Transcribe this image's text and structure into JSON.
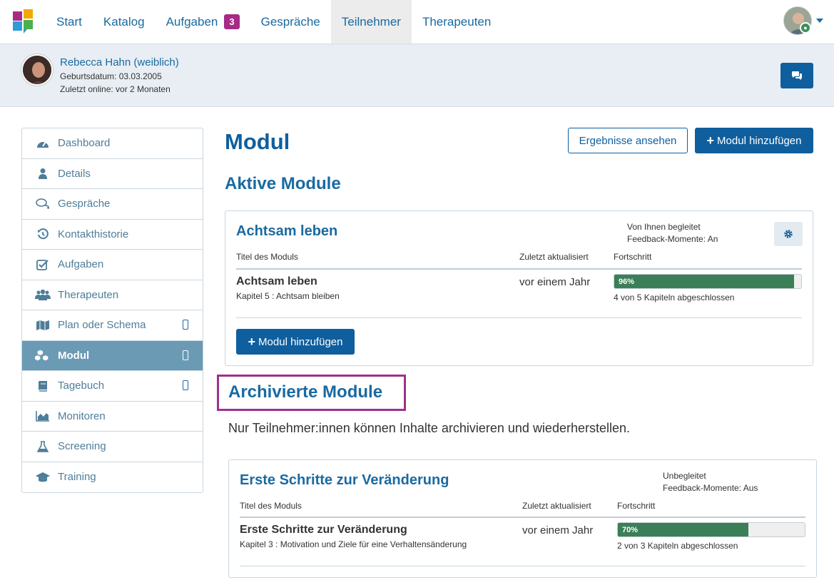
{
  "nav": {
    "items": [
      {
        "label": "Start"
      },
      {
        "label": "Katalog"
      },
      {
        "label": "Aufgaben",
        "badge": "3"
      },
      {
        "label": "Gespräche"
      },
      {
        "label": "Teilnehmer",
        "active": true
      },
      {
        "label": "Therapeuten"
      }
    ]
  },
  "participant": {
    "name": "Rebecca Hahn (weiblich)",
    "birthdate": "Geburtsdatum: 03.03.2005",
    "last_online": "Zuletzt online: vor 2 Monaten"
  },
  "sidebar": {
    "items": [
      {
        "label": "Dashboard",
        "icon": "dashboard-icon"
      },
      {
        "label": "Details",
        "icon": "user-icon"
      },
      {
        "label": "Gespräche",
        "icon": "chat-icon"
      },
      {
        "label": "Kontakthistorie",
        "icon": "history-icon"
      },
      {
        "label": "Aufgaben",
        "icon": "checkbox-icon"
      },
      {
        "label": "Therapeuten",
        "icon": "group-icon"
      },
      {
        "label": "Plan oder Schema",
        "icon": "map-icon",
        "mobile": true
      },
      {
        "label": "Modul",
        "icon": "cubes-icon",
        "mobile": true,
        "active": true
      },
      {
        "label": "Tagebuch",
        "icon": "book-icon",
        "mobile": true
      },
      {
        "label": "Monitoren",
        "icon": "area-chart-icon"
      },
      {
        "label": "Screening",
        "icon": "flask-icon"
      },
      {
        "label": "Training",
        "icon": "graduation-cap-icon"
      }
    ]
  },
  "page": {
    "title": "Modul",
    "results_button": "Ergebnisse ansehen",
    "add_module_button": "Modul hinzufügen"
  },
  "active": {
    "section_title": "Aktive Module",
    "card": {
      "title": "Achtsam leben",
      "meta_line1": "Von Ihnen begleitet",
      "meta_line2": "Feedback-Momente: An",
      "col_title": "Titel des Moduls",
      "col_updated": "Zuletzt aktualisiert",
      "col_progress": "Fortschritt",
      "row_title": "Achtsam leben",
      "row_sub": "Kapitel 5 : Achtsam bleiben",
      "row_updated": "vor einem Jahr",
      "progress_label": "96%",
      "progress_value": 96,
      "progress_text": "4 von 5 Kapiteln abgeschlossen",
      "add_button": "Modul hinzufügen"
    }
  },
  "archived": {
    "section_title": "Archivierte Module",
    "note": "Nur Teilnehmer:innen können Inhalte archivieren und wiederherstellen.",
    "card": {
      "title": "Erste Schritte zur Veränderung",
      "meta_line1": "Unbegleitet",
      "meta_line2": "Feedback-Momente: Aus",
      "col_title": "Titel des Moduls",
      "col_updated": "Zuletzt aktualisiert",
      "col_progress": "Fortschritt",
      "row_title": "Erste Schritte zur Veränderung",
      "row_sub": "Kapitel 3 : Motivation und Ziele für eine Verhaltensänderung",
      "row_updated": "vor einem Jahr",
      "progress_label": "70%",
      "progress_value": 70,
      "progress_text": "2 von 3 Kapiteln abgeschlossen"
    }
  },
  "colors": {
    "primary": "#0f5f9e",
    "link": "#1a6aa1",
    "badge": "#a62b87",
    "progress": "#3a7f57",
    "highlight": "#a0308a"
  }
}
